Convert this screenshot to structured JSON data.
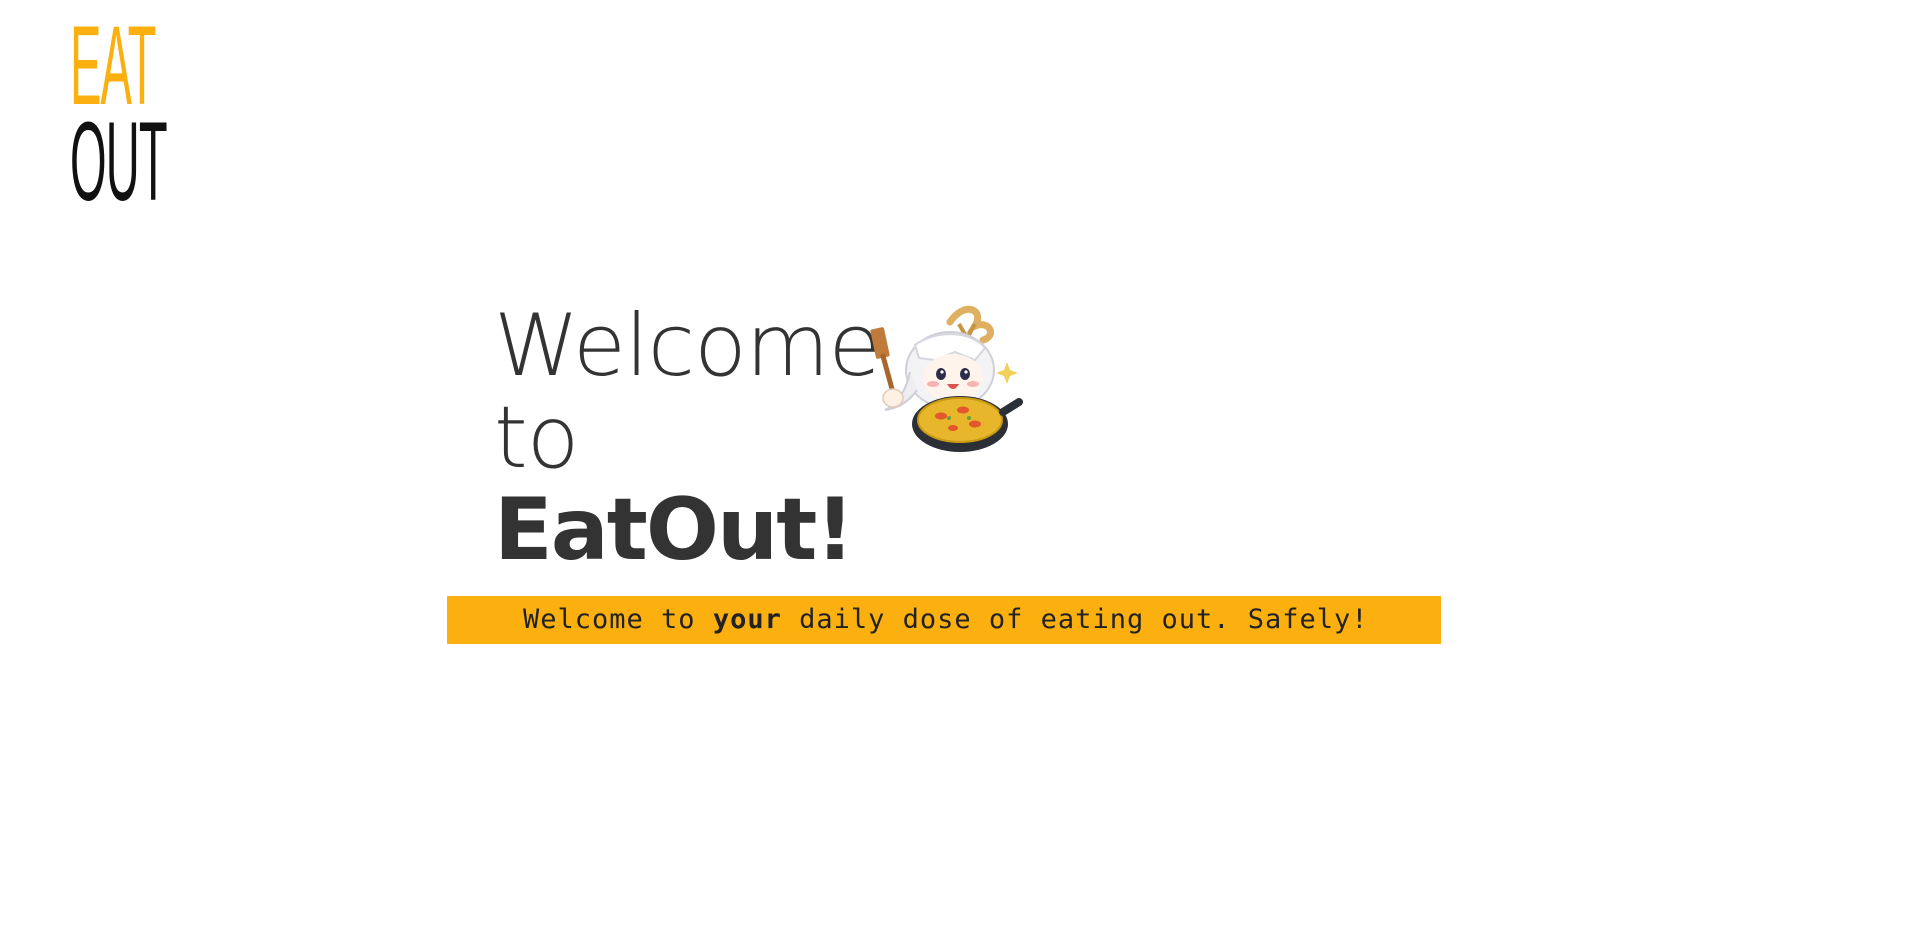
{
  "logo": {
    "line1": "EAT",
    "line2": "OUT",
    "colors": {
      "eat": "#fbb00f",
      "out": "#111111"
    }
  },
  "hero": {
    "welcome": "Welcome",
    "to": "to",
    "brand": "EatOut!"
  },
  "mascot": {
    "icon": "chef-mascot-with-paella-pan-icon"
  },
  "tagline": {
    "before": "Welcome to ",
    "emphasis": "your",
    "after": " daily dose of eating out. Safely!",
    "background": "#fbb00f"
  }
}
